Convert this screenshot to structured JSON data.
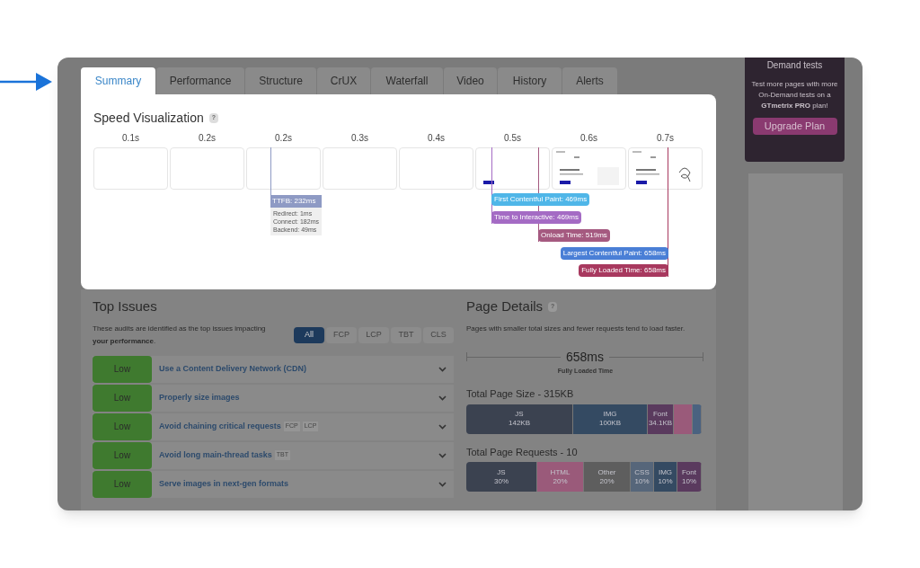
{
  "tabs": [
    {
      "label": "Summary",
      "selected": true
    },
    {
      "label": "Performance",
      "selected": false
    },
    {
      "label": "Structure",
      "selected": false
    },
    {
      "label": "CrUX",
      "selected": false
    },
    {
      "label": "Waterfall",
      "selected": false
    },
    {
      "label": "Video",
      "selected": false
    },
    {
      "label": "History",
      "selected": false
    },
    {
      "label": "Alerts",
      "selected": false
    }
  ],
  "speed_visualization": {
    "title": "Speed Visualization",
    "help": "?",
    "frames": [
      {
        "time": "0.1s",
        "kind": "blank"
      },
      {
        "time": "0.2s",
        "kind": "blank"
      },
      {
        "time": "0.2s",
        "kind": "blank"
      },
      {
        "time": "0.3s",
        "kind": "blank"
      },
      {
        "time": "0.4s",
        "kind": "blank"
      },
      {
        "time": "0.5s",
        "kind": "partial"
      },
      {
        "time": "0.6s",
        "kind": "content"
      },
      {
        "time": "0.7s",
        "kind": "content"
      }
    ],
    "ttfb": {
      "label": "TTFB: 232ms",
      "color": "#8e9ac4",
      "details": [
        "Redirect: 1ms",
        "Connect: 182ms",
        "Backend: 49ms"
      ]
    },
    "markers": [
      {
        "label": "First Contentful Paint: 469ms",
        "color": "#4fb6e8"
      },
      {
        "label": "Time to Interactive: 469ms",
        "color": "#a46bc4"
      },
      {
        "label": "Onload Time: 519ms",
        "color": "#a55a80"
      },
      {
        "label": "Largest Contentful Paint: 658ms",
        "color": "#4a7fd6"
      },
      {
        "label": "Fully Loaded Time: 658ms",
        "color": "#a8395f"
      }
    ]
  },
  "top_issues": {
    "title": "Top Issues",
    "description": "These audits are identified as the top issues impacting **your performance**.",
    "filters": [
      {
        "label": "All",
        "selected": true
      },
      {
        "label": "FCP",
        "selected": false
      },
      {
        "label": "LCP",
        "selected": false
      },
      {
        "label": "TBT",
        "selected": false
      },
      {
        "label": "CLS",
        "selected": false
      }
    ],
    "issues": [
      {
        "impact": "Low",
        "title": "Use a Content Delivery Network (CDN)"
      },
      {
        "impact": "Low",
        "title": "Properly size images"
      },
      {
        "impact": "Low",
        "title": "Avoid chaining critical requests",
        "tags": [
          "FCP",
          "LCP"
        ]
      },
      {
        "impact": "Low",
        "title": "Avoid long main-thread tasks",
        "tags": [
          "TBT"
        ]
      },
      {
        "impact": "Low",
        "title": "Serve images in next-gen formats"
      }
    ]
  },
  "page_details": {
    "title": "Page Details",
    "help": "?",
    "description": "Pages with smaller total sizes and fewer requests tend to load faster.",
    "fully_loaded": {
      "value": "658ms",
      "label": "Fully Loaded Time"
    },
    "size_bar": {
      "title": "Total Page Size - 315KB",
      "segments": [
        {
          "name": "JS",
          "value": "142KB",
          "color": "#3b4250"
        },
        {
          "name": "IMG",
          "value": "100KB",
          "color": "#344a62"
        },
        {
          "name": "Font",
          "value": "34.1KB",
          "color": "#5a3a5e"
        },
        {
          "color": "#9a5a7a"
        },
        {
          "color": "#4a6280"
        }
      ]
    },
    "requests_bar": {
      "title": "Total Page Requests - 10",
      "segments": [
        {
          "name": "JS",
          "value": "30%",
          "color": "#3b4250"
        },
        {
          "name": "HTML",
          "value": "20%",
          "color": "#9a5a7a"
        },
        {
          "name": "Other",
          "value": "20%",
          "color": "#5e5e5e"
        },
        {
          "name": "CSS",
          "value": "10%",
          "color": "#56667a"
        },
        {
          "name": "IMG",
          "value": "10%",
          "color": "#344a62"
        },
        {
          "name": "Font",
          "value": "10%",
          "color": "#5a3a5e"
        }
      ]
    }
  },
  "promo": {
    "title": "Demand tests",
    "text": "Test more pages with more On-Demand tests on a **GTmetrix PRO** plan!",
    "button": "Upgrade Plan"
  }
}
